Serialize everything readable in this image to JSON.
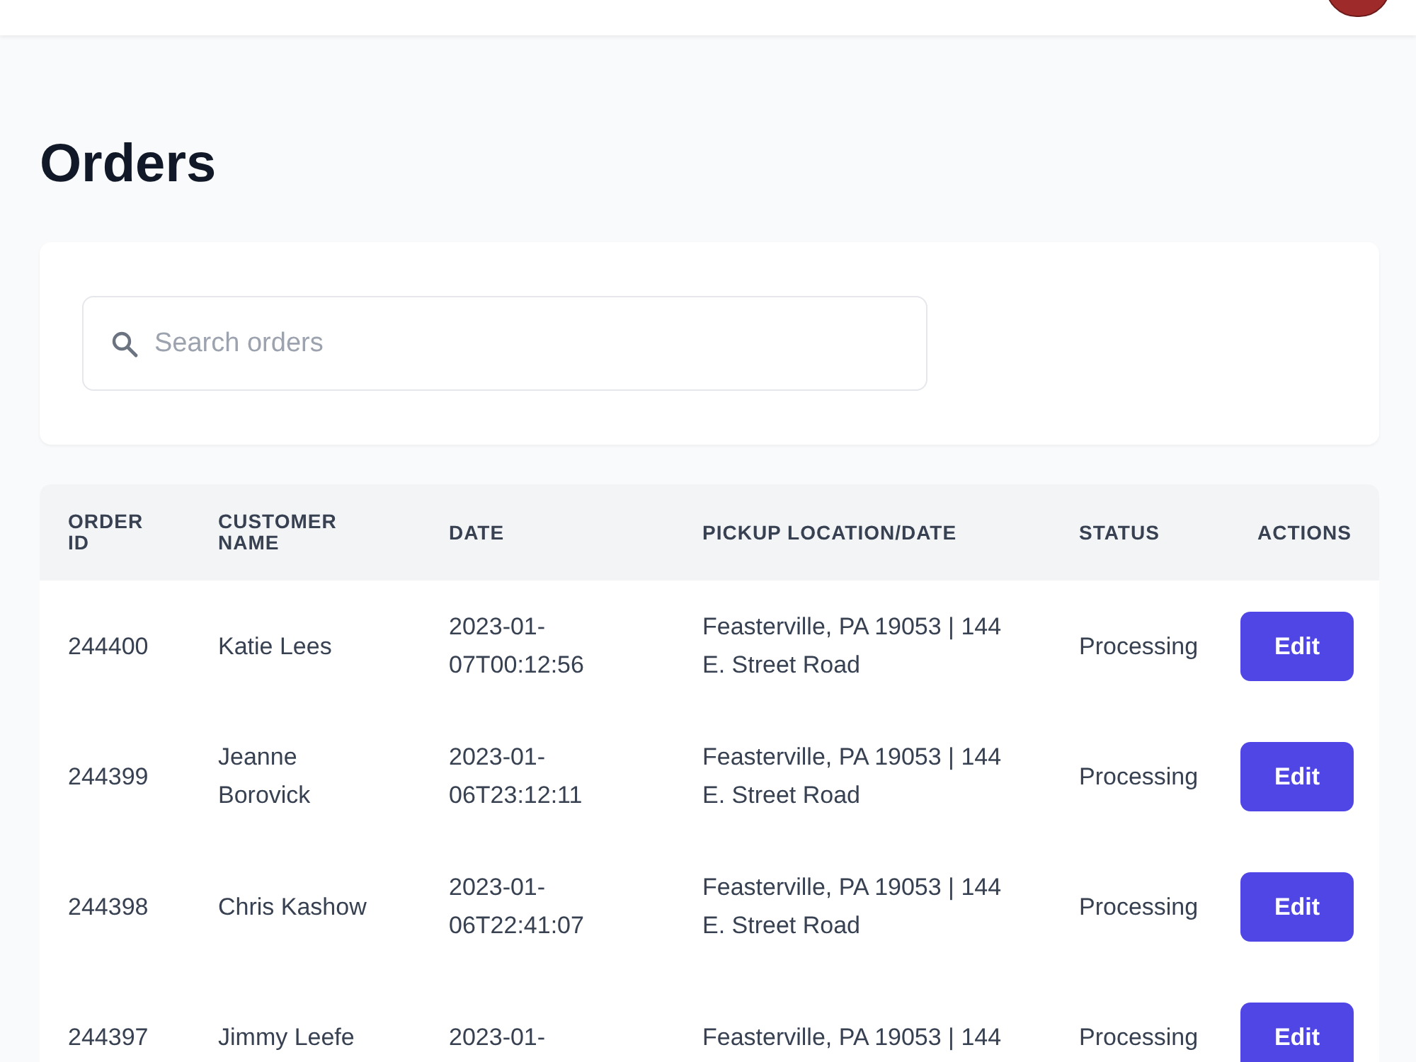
{
  "page": {
    "title": "Orders"
  },
  "search": {
    "placeholder": "Search orders"
  },
  "table": {
    "columns": [
      "ORDER ID",
      "CUSTOMER NAME",
      "DATE",
      "PICKUP LOCATION/DATE",
      "STATUS",
      "ACTIONS"
    ],
    "rows": [
      {
        "order_id": "244400",
        "customer": "Katie Lees",
        "date": "2023-01-07T00:12:56",
        "pickup": "Feasterville, PA 19053 | 144 E. Street Road",
        "status": "Processing",
        "action": "Edit"
      },
      {
        "order_id": "244399",
        "customer": "Jeanne Borovick",
        "date": "2023-01-06T23:12:11",
        "pickup": "Feasterville, PA 19053 | 144 E. Street Road",
        "status": "Processing",
        "action": "Edit"
      },
      {
        "order_id": "244398",
        "customer": "Chris Kashow",
        "date": "2023-01-06T22:41:07",
        "pickup": "Feasterville, PA 19053 | 144 E. Street Road",
        "status": "Processing",
        "action": "Edit"
      },
      {
        "order_id": "244397",
        "customer": "Jimmy Leefe",
        "date": "2023-01-",
        "pickup": "Feasterville, PA 19053 | 144",
        "status": "Processing",
        "action": "Edit"
      }
    ]
  }
}
